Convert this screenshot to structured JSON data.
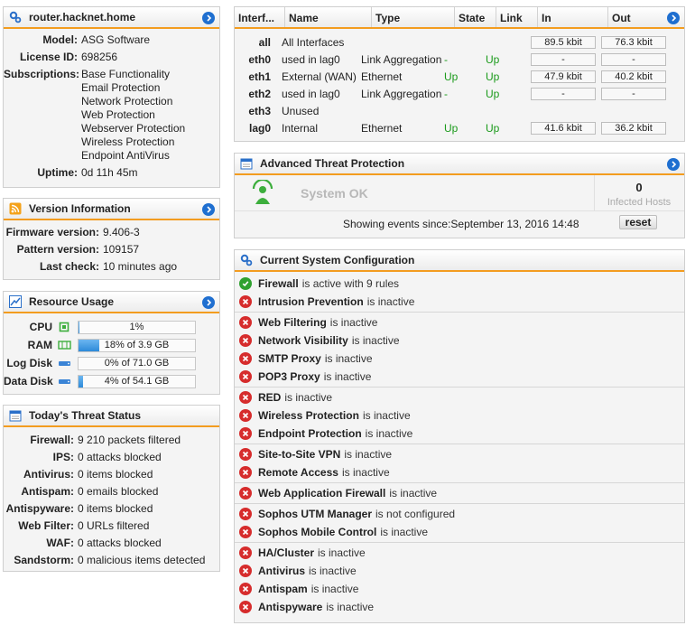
{
  "device": {
    "title": "router.hacknet.home",
    "rows": [
      {
        "label": "Model:",
        "value": "ASG Software"
      },
      {
        "label": "License ID:",
        "value": "698256"
      }
    ],
    "subscriptions_label": "Subscriptions:",
    "subscriptions": [
      "Base Functionality",
      "Email Protection",
      "Network Protection",
      "Web Protection",
      "Webserver Protection",
      "Wireless Protection",
      "Endpoint AntiVirus"
    ],
    "uptime_label": "Uptime:",
    "uptime": "0d 11h 45m"
  },
  "version": {
    "title": "Version Information",
    "rows": [
      {
        "label": "Firmware version:",
        "value": "9.406-3"
      },
      {
        "label": "Pattern version:",
        "value": "109157"
      },
      {
        "label": "Last check:",
        "value": "10 minutes ago"
      }
    ]
  },
  "resources": {
    "title": "Resource Usage",
    "rows": [
      {
        "label": "CPU",
        "text": "1%",
        "fraction": 0.01
      },
      {
        "label": "RAM",
        "text": "18% of 3.9 GB",
        "fraction": 0.18
      },
      {
        "label": "Log Disk",
        "text": "0% of 71.0 GB",
        "fraction": 0.0
      },
      {
        "label": "Data Disk",
        "text": "4% of 54.1 GB",
        "fraction": 0.04
      }
    ]
  },
  "threat": {
    "title": "Today's Threat Status",
    "rows": [
      {
        "label": "Firewall:",
        "value": "9 210 packets filtered"
      },
      {
        "label": "IPS:",
        "value": "0 attacks blocked"
      },
      {
        "label": "Antivirus:",
        "value": "0 items blocked"
      },
      {
        "label": "Antispam:",
        "value": "0 emails blocked"
      },
      {
        "label": "Antispyware:",
        "value": "0 items blocked"
      },
      {
        "label": "Web Filter:",
        "value": "0 URLs filtered"
      },
      {
        "label": "WAF:",
        "value": "0 attacks blocked"
      },
      {
        "label": "Sandstorm:",
        "value": "0 malicious items detected"
      }
    ]
  },
  "interfaces": {
    "headers": [
      "Interf...",
      "Name",
      "Type",
      "State",
      "Link",
      "In",
      "Out"
    ],
    "rows": [
      {
        "iface": "all",
        "name": "All Interfaces",
        "type": "",
        "state": "",
        "link": "",
        "in": "89.5 kbit",
        "out": "76.3 kbit",
        "show_bw": true
      },
      {
        "iface": "eth0",
        "name": "used in lag0",
        "type": "Link Aggregation",
        "state": "-",
        "link": "Up",
        "in": "-",
        "out": "-",
        "show_bw": true
      },
      {
        "iface": "eth1",
        "name": "External (WAN)",
        "type": "Ethernet",
        "state": "Up",
        "link": "Up",
        "in": "47.9 kbit",
        "out": "40.2 kbit",
        "show_bw": true
      },
      {
        "iface": "eth2",
        "name": "used in lag0",
        "type": "Link Aggregation",
        "state": "-",
        "link": "Up",
        "in": "-",
        "out": "-",
        "show_bw": true
      },
      {
        "iface": "eth3",
        "name": "Unused",
        "type": "",
        "state": "",
        "link": "",
        "in": "",
        "out": "",
        "show_bw": false
      },
      {
        "iface": "lag0",
        "name": "Internal",
        "type": "Ethernet",
        "state": "Up",
        "link": "Up",
        "in": "41.6 kbit",
        "out": "36.2 kbit",
        "show_bw": true
      }
    ]
  },
  "atp": {
    "title": "Advanced Threat Protection",
    "status": "System OK",
    "infected_count": "0",
    "infected_label": "Infected Hosts",
    "since": "Showing events since:September 13, 2016 14:48",
    "reset_label": "reset"
  },
  "config": {
    "title": "Current System Configuration",
    "groups": [
      [
        {
          "name": "Firewall",
          "status": "is active with 9 rules",
          "ok": true
        },
        {
          "name": "Intrusion Prevention",
          "status": "is inactive",
          "ok": false
        }
      ],
      [
        {
          "name": "Web Filtering",
          "status": "is inactive",
          "ok": false
        },
        {
          "name": "Network Visibility",
          "status": "is inactive",
          "ok": false
        },
        {
          "name": "SMTP Proxy",
          "status": "is inactive",
          "ok": false
        },
        {
          "name": "POP3 Proxy",
          "status": "is inactive",
          "ok": false
        }
      ],
      [
        {
          "name": "RED",
          "status": "is inactive",
          "ok": false
        },
        {
          "name": "Wireless Protection",
          "status": "is inactive",
          "ok": false
        },
        {
          "name": "Endpoint Protection",
          "status": "is inactive",
          "ok": false
        }
      ],
      [
        {
          "name": "Site-to-Site VPN",
          "status": "is inactive",
          "ok": false
        },
        {
          "name": "Remote Access",
          "status": "is inactive",
          "ok": false
        }
      ],
      [
        {
          "name": "Web Application Firewall",
          "status": "is inactive",
          "ok": false
        }
      ],
      [
        {
          "name": "Sophos UTM Manager",
          "status": "is not configured",
          "ok": false
        },
        {
          "name": "Sophos Mobile Control",
          "status": "is inactive",
          "ok": false
        }
      ],
      [
        {
          "name": "HA/Cluster",
          "status": "is inactive",
          "ok": false
        },
        {
          "name": "Antivirus",
          "status": "is inactive",
          "ok": false
        },
        {
          "name": "Antispam",
          "status": "is inactive",
          "ok": false
        },
        {
          "name": "Antispyware",
          "status": "is inactive",
          "ok": false
        }
      ]
    ]
  },
  "colors": {
    "accent": "#f39c1f",
    "info": "#1f6fd0",
    "ok": "#2fa12f",
    "error": "#d62c2c",
    "up": "#1a9a1a"
  }
}
